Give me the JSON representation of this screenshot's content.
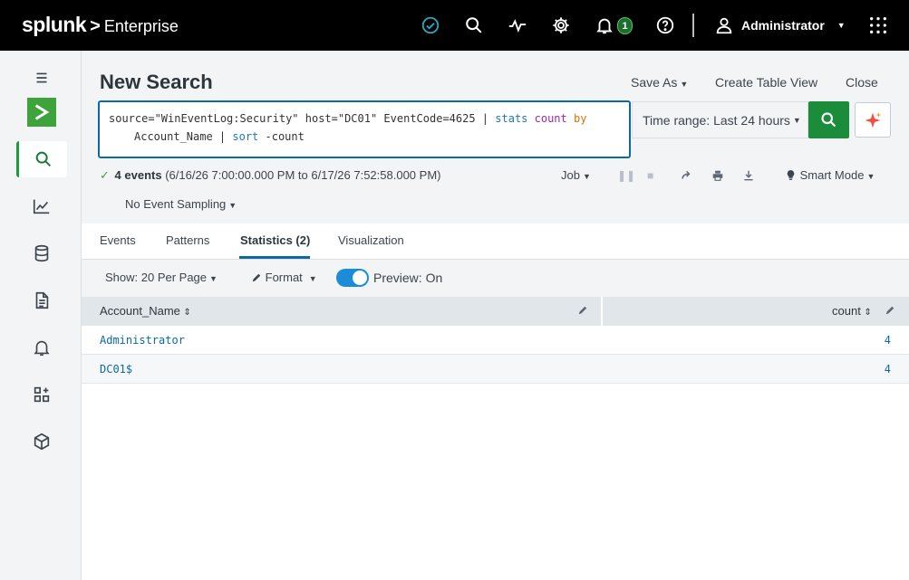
{
  "topbar": {
    "logo": "splunk",
    "chevron": ">",
    "product": "Enterprise",
    "notification_count": "1",
    "user": "Administrator"
  },
  "sidebar": {
    "items": [
      {
        "icon": "menu-icon"
      },
      {
        "icon": "splunk-logo"
      },
      {
        "icon": "search-icon"
      },
      {
        "icon": "chart-icon"
      },
      {
        "icon": "database-icon"
      },
      {
        "icon": "document-icon"
      },
      {
        "icon": "bell-icon"
      },
      {
        "icon": "apps-icon"
      },
      {
        "icon": "package-icon"
      }
    ]
  },
  "header": {
    "title": "New Search",
    "save_as": "Save As",
    "create_table_view": "Create Table View",
    "close": "Close"
  },
  "search": {
    "part1": "source=\"WinEventLog:Security\" host=\"DC01\" EventCode=4625 | ",
    "stats": "stats",
    "count": "count",
    "by": "by",
    "part2": "Account_Name | ",
    "sort": "sort",
    "part3": " -count",
    "time_range": "Time range: Last 24 hours"
  },
  "status": {
    "events": "4 events",
    "range": "(6/16/26 7:00:00.000 PM to 6/17/26 7:52:58.000 PM)",
    "job": "Job",
    "mode": "Smart Mode",
    "sampling": "No Event Sampling"
  },
  "tabs": [
    {
      "label": "Events"
    },
    {
      "label": "Patterns"
    },
    {
      "label": "Statistics (2)"
    },
    {
      "label": "Visualization"
    }
  ],
  "toolbar": {
    "per_page": "Show: 20 Per Page",
    "format": "Format",
    "preview": "Preview: On"
  },
  "table": {
    "columns": [
      "Account_Name",
      "count"
    ],
    "rows": [
      {
        "name": "Administrator",
        "count": "4"
      },
      {
        "name": "DC01$",
        "count": "4"
      }
    ]
  },
  "colors": {
    "accent_blue": "#0b6aa1",
    "go_green": "#1a8c3a",
    "topbar": "#000000"
  }
}
